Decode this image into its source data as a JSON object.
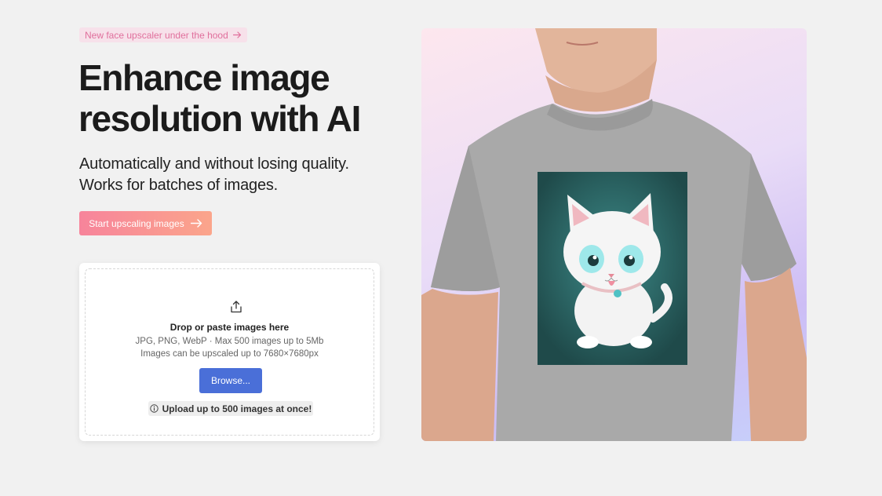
{
  "badge": {
    "label": "New face upscaler under the hood",
    "icon": "arrow-right-icon",
    "color": "#e06f9c"
  },
  "hero": {
    "title": "Enhance image resolution with AI",
    "subtitle_line1": "Automatically and without losing quality.",
    "subtitle_line2": "Works for batches of images.",
    "cta_label": "Start upscaling images",
    "cta_icon": "arrow-right-icon"
  },
  "upload": {
    "icon": "upload-icon",
    "title": "Drop or paste images here",
    "formats": "JPG, PNG, WebP · Max 500 images up to 5Mb",
    "max_resolution": "Images can be upscaled up to 7680×7680px",
    "browse_label": "Browse...",
    "note": "Upload up to 500 images at once!",
    "note_icon": "info-icon",
    "accent": "#4a6fd8"
  },
  "preview": {
    "alt": "Man in gray t-shirt with cartoon white cat print",
    "shirt_color": "#a9a9a9",
    "print_bg": "#2f6b6a"
  }
}
